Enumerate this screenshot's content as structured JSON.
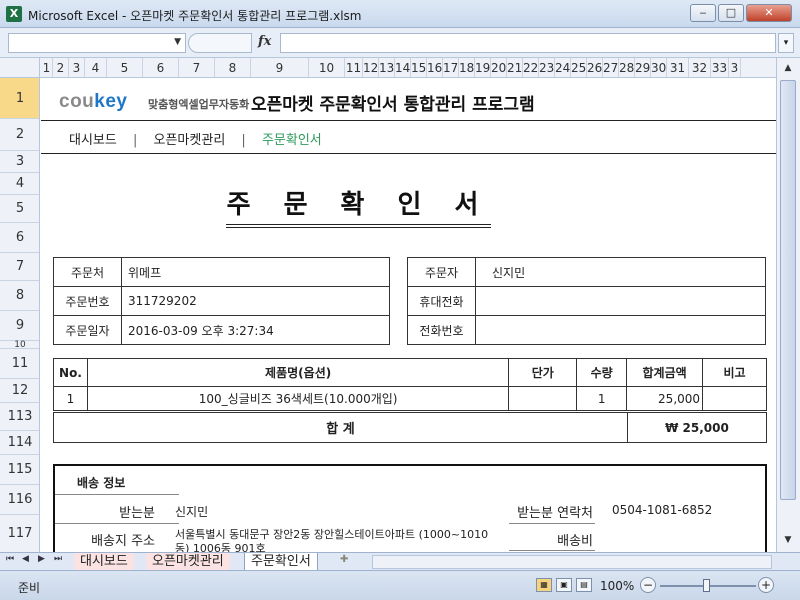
{
  "window": {
    "title": "Microsoft Excel - 오픈마켓 주문확인서 통합관리 프로그램.xlsm",
    "app_icon": "X",
    "minimize": "‒",
    "maximize": "□",
    "close": "✕"
  },
  "formula_bar": {
    "name_box": "",
    "fx": "fx",
    "content": ""
  },
  "columns": [
    "1",
    "2",
    "3",
    "4",
    "5",
    "6",
    "7",
    "8",
    "9",
    "10",
    "11",
    "12",
    "13",
    "14",
    "15",
    "16",
    "17",
    "18",
    "19",
    "20",
    "21",
    "22",
    "23",
    "24",
    "25",
    "26",
    "27",
    "28",
    "29",
    "30",
    "31",
    "32",
    "33",
    "3"
  ],
  "rows": [
    "1",
    "2",
    "3",
    "4",
    "5",
    "6",
    "7",
    "8",
    "9",
    "10",
    "11",
    "12",
    "113",
    "114",
    "115",
    "116",
    "117"
  ],
  "header": {
    "logo_prefix": "cou",
    "logo_suffix": "key",
    "logo_tagline": "맞춤형엑셀업무자동화",
    "title": "오픈마켓 주문확인서 통합관리 프로그램"
  },
  "nav": {
    "items": [
      "대시보드",
      "오픈마켓관리",
      "주문확인서"
    ],
    "separator": "|"
  },
  "document": {
    "title": "주 문 확 인 서",
    "order_info": {
      "vendor_label": "주문처",
      "vendor_value": "위메프",
      "number_label": "주문번호",
      "number_value": "311729202",
      "date_label": "주문일자",
      "date_value": "2016-03-09 오후 3:27:34"
    },
    "customer_info": {
      "orderer_label": "주문자",
      "orderer_value": "신지민",
      "mobile_label": "휴대전화",
      "mobile_value": "",
      "phone_label": "전화번호",
      "phone_value": ""
    },
    "items_table": {
      "headers": [
        "No.",
        "제품명(옵션)",
        "단가",
        "수량",
        "합계금액",
        "비고"
      ],
      "rows": [
        {
          "no": "1",
          "name": "100_싱글비즈 36색세트(10.000개입)",
          "unit_price": "",
          "qty": "1",
          "total": "25,000",
          "note": ""
        }
      ],
      "sum_label": "합   계",
      "sum_value": "₩ 25,000"
    },
    "shipping": {
      "title": "배송 정보",
      "recipient_label": "받는분",
      "recipient_value": "신지민",
      "recipient_contact_label": "받는분 연락처",
      "recipient_contact_value": "0504-1081-6852",
      "address_label": "배송지 주소",
      "address_line1": "서울특별시 동대문구 장안2동 장안힐스테이트아파트 (1000~1010",
      "address_line2": "동) 1006동 901호",
      "fee_label": "배송비",
      "fee_value": ""
    }
  },
  "sheet_tabs": {
    "nav_buttons": [
      "⏮",
      "◀",
      "▶",
      "⏭"
    ],
    "tabs": [
      "대시보드",
      "오픈마켓관리",
      "주문확인서"
    ],
    "active": "주문확인서"
  },
  "status_bar": {
    "status": "준비",
    "zoom": "100%",
    "zoom_minus": "−",
    "zoom_plus": "+"
  }
}
